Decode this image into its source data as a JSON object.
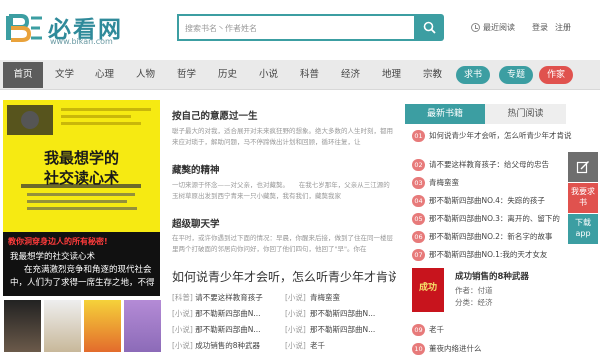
{
  "header": {
    "logo_text": "必看网",
    "logo_sub": "www.bikan.com",
    "search_placeholder": "搜索书名丶作者姓名",
    "recent": "最近阅读",
    "login": "登录",
    "register": "注册"
  },
  "nav": {
    "home": "首页",
    "items": [
      "文学",
      "心理",
      "人物",
      "哲学",
      "历史",
      "小说",
      "科普",
      "经济",
      "地理",
      "宗教"
    ],
    "pills": [
      {
        "label": "求书",
        "color": "#3c9ea2"
      },
      {
        "label": "专题",
        "color": "#3c9ea2"
      },
      {
        "label": "作家",
        "color": "#e0524e"
      }
    ]
  },
  "cover": {
    "top_text": "我最想学的",
    "title_line1": "我最想学的",
    "title_line2": "社交读心术",
    "red_text": "教你洞穿身边人的所有秘密!",
    "caption_line1": "我最想学的社交读心术",
    "caption_line2": "在充满激烈竞争和角逐的现代社会",
    "caption_line3": "中，人们为了求得一席生存之地，不得"
  },
  "articles": [
    {
      "title": "按自己的意愿过一生",
      "body": "聪子最大的对我，适合展开对未来疯狂野的想象。绝大多数的人生时刻，都用来应对琐于，解助问题，马不停蹄做出计划和回顾，循环往复，让"
    },
    {
      "title": "藏獒的精神",
      "body": "一切来源于怀念——对父亲，也对藏獒。　　在我七岁那年，父亲从三江源的玉树草原出发到西宁青来一只小藏獒，我有我们，藏獒我家"
    },
    {
      "title": "超级聊天学",
      "body": "在平时，或许你遇到过下面的情况：早晨，你醒来后接，做到了住在同一楼层里两个打破面的邻居向你问好，你回了他们四句，他回了\"早\"。你在"
    }
  ],
  "featured_title": "如何说青少年才会听，怎么听青少年才肯说",
  "list": [
    {
      "tag1": "[科普]",
      "t1": "请不要这样教育孩子",
      "tag2": "[小说]",
      "t2": "青梅蛮蛮"
    },
    {
      "tag1": "[小说]",
      "t1": "那不勒斯四部曲N...",
      "tag2": "[小说]",
      "t2": "那不勒斯四部曲N..."
    },
    {
      "tag1": "[小说]",
      "t1": "那不勒斯四部曲N...",
      "tag2": "[小说]",
      "t2": "那不勒斯四部曲N..."
    },
    {
      "tag1": "[小说]",
      "t1": "成功销售的8种武器",
      "tag2": "[小说]",
      "t2": "老千"
    }
  ],
  "rank": {
    "tab_new": "最新书籍",
    "tab_hot": "热门阅读",
    "items": [
      {
        "num": "01",
        "text": "如何说青少年才会听，怎么听青少年才肯说"
      },
      {
        "num": "02",
        "text": "请不要这样教育孩子：给父母的忠告"
      },
      {
        "num": "03",
        "text": "青梅蛮蛮"
      },
      {
        "num": "04",
        "text": "那不勒斯四部曲NO.4：失踪的孩子"
      },
      {
        "num": "05",
        "text": "那不勒斯四部曲NO.3：离开的、留下的"
      },
      {
        "num": "06",
        "text": "那不勒斯四部曲NO.2：新名字的故事"
      },
      {
        "num": "07",
        "text": "那不勒斯四部曲NO.1:我的天才女友"
      }
    ],
    "featured": {
      "title": "成功销售的8种武器",
      "author": "作者：付道",
      "category": "分类：经济",
      "cover_text": "成功"
    },
    "after": [
      {
        "num": "09",
        "text": "老千"
      },
      {
        "num": "10",
        "text": "董夜内络进什么"
      }
    ]
  },
  "side": {
    "want_book": "我要求书",
    "download": "下载app"
  }
}
